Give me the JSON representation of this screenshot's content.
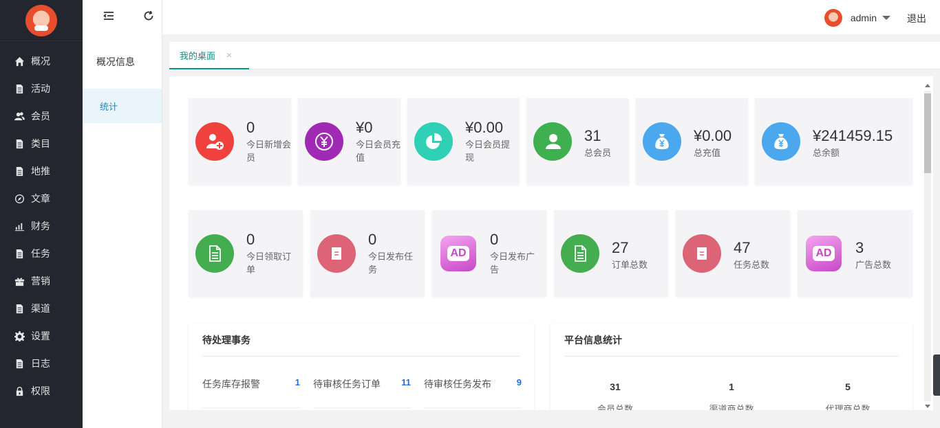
{
  "sidebar": {
    "items": [
      {
        "label": "概况",
        "icon": "home-icon"
      },
      {
        "label": "活动",
        "icon": "document-icon"
      },
      {
        "label": "会员",
        "icon": "users-icon"
      },
      {
        "label": "类目",
        "icon": "document-icon"
      },
      {
        "label": "地推",
        "icon": "document-icon"
      },
      {
        "label": "文章",
        "icon": "compass-icon"
      },
      {
        "label": "财务",
        "icon": "bar-chart-icon"
      },
      {
        "label": "任务",
        "icon": "document-icon"
      },
      {
        "label": "营销",
        "icon": "gift-icon"
      },
      {
        "label": "渠道",
        "icon": "document-icon"
      },
      {
        "label": "设置",
        "icon": "gear-icon"
      },
      {
        "label": "日志",
        "icon": "document-icon"
      },
      {
        "label": "权限",
        "icon": "lock-icon"
      }
    ]
  },
  "subnav": {
    "title": "概况信息",
    "active_item": "统计"
  },
  "header": {
    "username": "admin",
    "logout": "退出"
  },
  "tabs": [
    {
      "label": "我的桌面",
      "close": "×"
    }
  ],
  "stats_row1": [
    {
      "value": "0",
      "label": "今日新增会员",
      "icon": "add-user-icon",
      "color": "#f0423c"
    },
    {
      "value": "¥0",
      "label": "今日会员充值",
      "icon": "yen-icon",
      "color": "#a02ab4"
    },
    {
      "value": "¥0.00",
      "label": "今日会员提现",
      "icon": "pie-icon",
      "color": "#2fd0b5"
    },
    {
      "value": "31",
      "label": "总会员",
      "icon": "user-icon",
      "color": "#3fb04f"
    },
    {
      "value": "¥0.00",
      "label": "总充值",
      "icon": "money-bag-icon",
      "color": "#4ca8ee"
    },
    {
      "value": "¥241459.15",
      "label": "总余额",
      "icon": "money-bag-icon",
      "color": "#4ca8ee"
    }
  ],
  "stats_row2": [
    {
      "value": "0",
      "label": "今日领取订单",
      "icon": "file-icon",
      "color": "#43ad4f"
    },
    {
      "value": "0",
      "label": "今日发布任务",
      "icon": "task-icon",
      "color": "#dc6476"
    },
    {
      "value": "0",
      "label": "今日发布广告",
      "icon": "ad-icon",
      "color": "#c648c6"
    },
    {
      "value": "27",
      "label": "订单总数",
      "icon": "file-icon",
      "color": "#43ad4f"
    },
    {
      "value": "47",
      "label": "任务总数",
      "icon": "task-icon",
      "color": "#dc6476"
    },
    {
      "value": "3",
      "label": "广告总数",
      "icon": "ad-icon",
      "color": "#c648c6"
    }
  ],
  "ad_text": "AD",
  "pending": {
    "title": "待处理事务",
    "items": [
      {
        "label": "任务库存报警",
        "count": "1"
      },
      {
        "label": "待审核任务订单",
        "count": "11"
      },
      {
        "label": "待审核任务发布",
        "count": "9"
      }
    ]
  },
  "platform": {
    "title": "平台信息统计",
    "items": [
      {
        "value": "31",
        "label": "会员总数"
      },
      {
        "value": "1",
        "label": "渠道商总数"
      },
      {
        "value": "5",
        "label": "代理商总数"
      }
    ]
  }
}
